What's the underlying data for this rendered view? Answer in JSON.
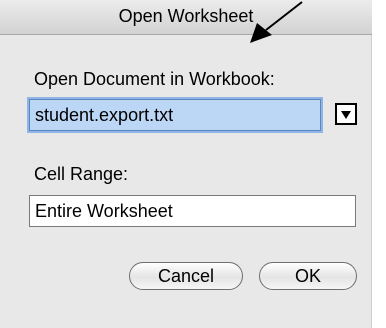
{
  "dialog": {
    "title": "Open Worksheet",
    "document_label": "Open Document in Workbook:",
    "document_value": "student.export.txt",
    "range_label": "Cell Range:",
    "range_value": "Entire Worksheet",
    "cancel_label": "Cancel",
    "ok_label": "OK"
  },
  "icons": {
    "dropdown": "chevron-down-icon",
    "annotation": "arrow-icon"
  },
  "colors": {
    "dialog_background": "#e8e8e8",
    "selection": "#bcd6f5"
  }
}
